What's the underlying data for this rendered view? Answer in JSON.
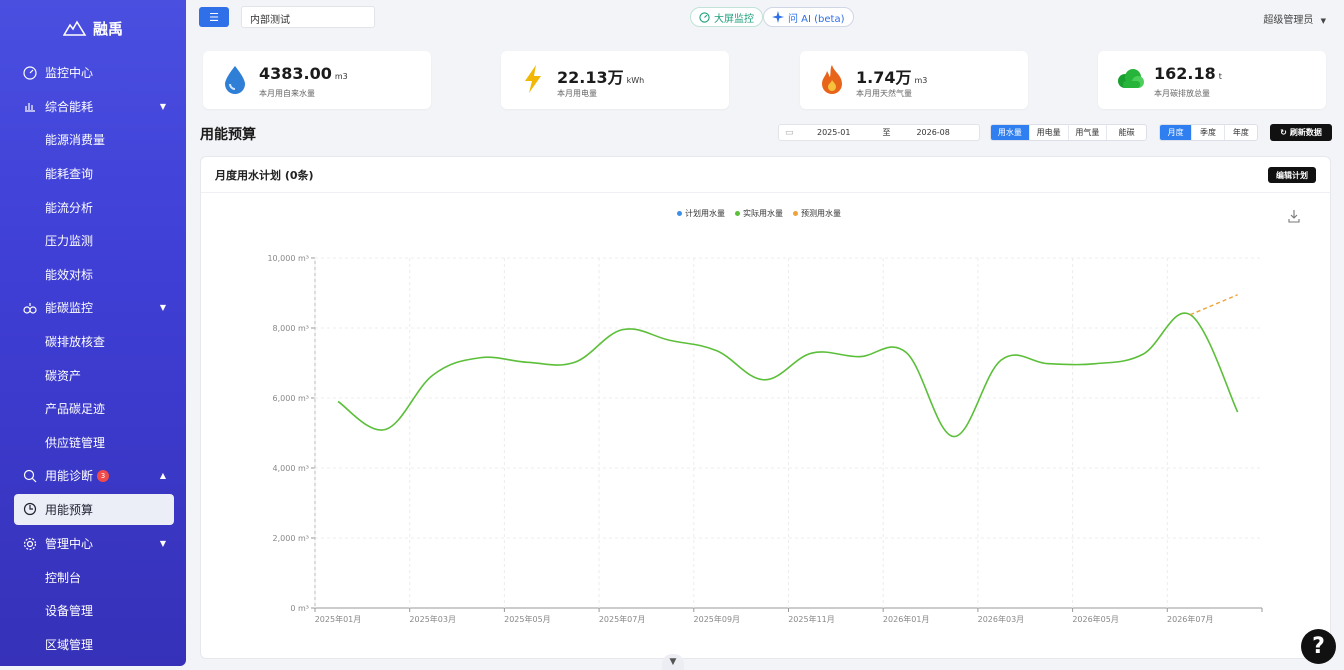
{
  "brand": {
    "name": "融禹"
  },
  "sidebar": {
    "items": [
      {
        "label": "监控中心",
        "icon": "dashboard-icon",
        "type": "top"
      },
      {
        "label": "综合能耗",
        "icon": "chart-icon",
        "type": "group",
        "expanded": true
      },
      {
        "label": "能源消费量",
        "type": "sub"
      },
      {
        "label": "能耗查询",
        "type": "sub"
      },
      {
        "label": "能流分析",
        "type": "sub"
      },
      {
        "label": "压力监测",
        "type": "sub"
      },
      {
        "label": "能效对标",
        "type": "sub"
      },
      {
        "label": "能碳监控",
        "icon": "carbon-icon",
        "type": "group",
        "expanded": true
      },
      {
        "label": "碳排放核查",
        "type": "sub"
      },
      {
        "label": "碳资产",
        "type": "sub"
      },
      {
        "label": "产品碳足迹",
        "type": "sub"
      },
      {
        "label": "供应链管理",
        "type": "sub"
      },
      {
        "label": "用能诊断",
        "icon": "diagnosis-icon",
        "type": "group",
        "badge": "3",
        "expanded": true
      },
      {
        "label": "用能预算",
        "icon": "budget-icon",
        "type": "active"
      },
      {
        "label": "管理中心",
        "icon": "settings-icon",
        "type": "group",
        "expanded": true
      },
      {
        "label": "控制台",
        "type": "sub"
      },
      {
        "label": "设备管理",
        "type": "sub"
      },
      {
        "label": "区域管理",
        "type": "sub"
      }
    ]
  },
  "topbar": {
    "tenant": "内部测试",
    "big_screen": "大屏监控",
    "ask_ai": "问 AI (beta)",
    "user": "超级管理员"
  },
  "stats": [
    {
      "value": "4383.00",
      "unit": "m3",
      "label": "本月用自来水量",
      "icon": "water-drop-icon",
      "color": "#2f7fd6"
    },
    {
      "value": "22.13万",
      "unit": "kWh",
      "label": "本月用电量",
      "icon": "lightning-icon",
      "color": "#f2b705"
    },
    {
      "value": "1.74万",
      "unit": "m3",
      "label": "本月用天然气量",
      "icon": "flame-icon",
      "color": "#e8641b"
    },
    {
      "value": "162.18",
      "unit": "t",
      "label": "本月碳排放总量",
      "icon": "cloud-icon",
      "color": "#27b43a"
    }
  ],
  "section": {
    "title": "用能预算",
    "date_start": "2025-01",
    "date_sep": "至",
    "date_end": "2026-08",
    "energy_tabs": [
      "用水量",
      "用电量",
      "用气量",
      "能碳"
    ],
    "period_tabs": [
      "月度",
      "季度",
      "年度"
    ],
    "refresh": "刷新数据"
  },
  "panel": {
    "title": "月度用水计划 (0条)",
    "edit": "编辑计划"
  },
  "chart_data": {
    "type": "line",
    "legend": [
      "计划用水量",
      "实际用水量",
      "预测用水量"
    ],
    "legend_colors": [
      "#3b8fe8",
      "#5cbf3a",
      "#f0a23a"
    ],
    "x_ticks": [
      "2025年01月",
      "2025年03月",
      "2025年05月",
      "2025年07月",
      "2025年09月",
      "2025年11月",
      "2026年01月",
      "2026年03月",
      "2026年05月",
      "2026年07月"
    ],
    "y_ticks": [
      "0 m³",
      "2,000 m³",
      "4,000 m³",
      "6,000 m³",
      "8,000 m³",
      "10,000 m³"
    ],
    "ylim": [
      0,
      10000
    ],
    "series": [
      {
        "name": "计划用水量",
        "values": []
      },
      {
        "name": "实际用水量",
        "x": [
          "2025-01",
          "2025-02",
          "2025-03",
          "2025-04",
          "2025-05",
          "2025-06",
          "2025-07",
          "2025-08",
          "2025-09",
          "2025-10",
          "2025-11",
          "2025-12",
          "2026-01",
          "2026-02",
          "2026-03",
          "2026-04",
          "2026-05",
          "2026-06",
          "2026-07",
          "2026-08"
        ],
        "values": [
          5900,
          5100,
          6650,
          7150,
          7020,
          7020,
          7950,
          7650,
          7350,
          6520,
          7280,
          7180,
          7300,
          4900,
          7080,
          6980,
          6980,
          7250,
          8380,
          5600
        ]
      },
      {
        "name": "预测用水量",
        "x": [
          "2026-07",
          "2026-08"
        ],
        "values": [
          8380,
          8950
        ]
      }
    ]
  }
}
